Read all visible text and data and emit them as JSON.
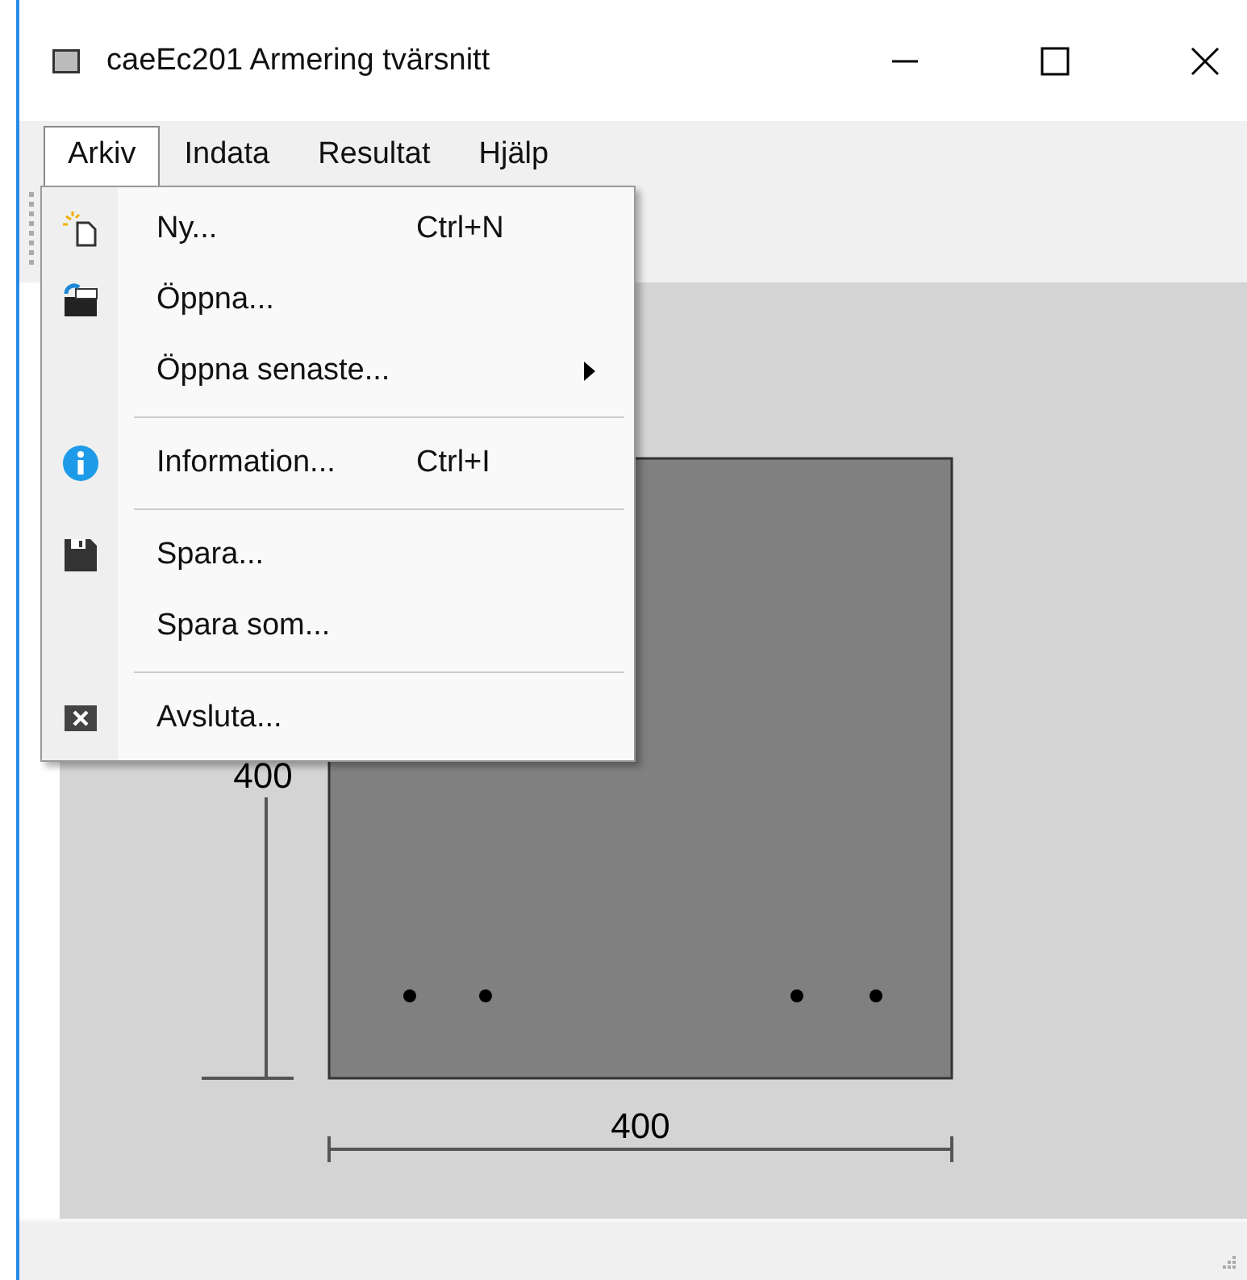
{
  "window": {
    "title": "caeEc201 Armering tvärsnitt"
  },
  "menu_bar": [
    {
      "label": "Arkiv",
      "selected": true
    },
    {
      "label": "Indata",
      "selected": false
    },
    {
      "label": "Resultat",
      "selected": false
    },
    {
      "label": "Hjälp",
      "selected": false
    }
  ],
  "file_menu": {
    "items": [
      {
        "kind": "item",
        "label": "Ny...",
        "shortcut": "Ctrl+N",
        "has_submenu": false
      },
      {
        "kind": "item",
        "label": "Öppna...",
        "has_submenu": false
      },
      {
        "kind": "item",
        "label": "Öppna senaste...",
        "has_submenu": true
      },
      {
        "kind": "separator"
      },
      {
        "kind": "item",
        "label": "Information...",
        "shortcut": "Ctrl+I",
        "has_submenu": false
      },
      {
        "kind": "separator"
      },
      {
        "kind": "item",
        "label": "Spara...",
        "has_submenu": false
      },
      {
        "kind": "item",
        "label": "Spara som...",
        "has_submenu": false
      },
      {
        "kind": "separator"
      },
      {
        "kind": "item",
        "label": "Avsluta...",
        "has_submenu": false
      }
    ]
  },
  "section": {
    "height_label": "400",
    "width_label": "400"
  }
}
